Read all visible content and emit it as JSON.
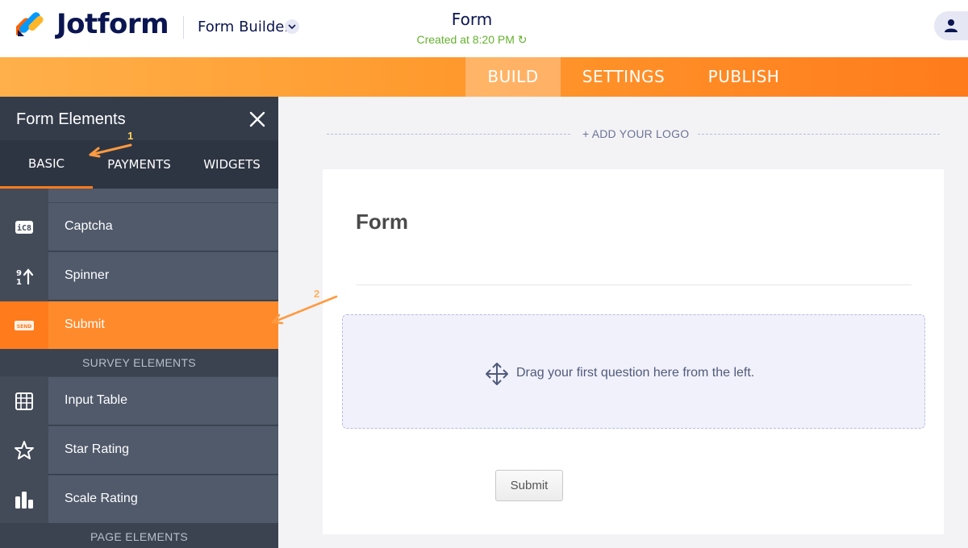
{
  "header": {
    "brand": "Jotform",
    "builder_label": "Form Builder",
    "form_title": "Form",
    "created": "Created at 8:20 PM"
  },
  "nav": {
    "tabs": [
      {
        "label": "BUILD",
        "active": true
      },
      {
        "label": "SETTINGS",
        "active": false
      },
      {
        "label": "PUBLISH",
        "active": false
      }
    ]
  },
  "sidebar": {
    "title": "Form Elements",
    "tabs": [
      {
        "label": "BASIC",
        "active": true
      },
      {
        "label": "PAYMENTS",
        "active": false
      },
      {
        "label": "WIDGETS",
        "active": false
      }
    ],
    "items": [
      {
        "label": "Captcha",
        "icon": "captcha-icon"
      },
      {
        "label": "Spinner",
        "icon": "spinner-icon"
      },
      {
        "label": "Submit",
        "icon": "send-icon",
        "active": true
      }
    ],
    "section_survey": "SURVEY ELEMENTS",
    "survey_items": [
      {
        "label": "Input Table",
        "icon": "table-icon"
      },
      {
        "label": "Star Rating",
        "icon": "star-icon"
      },
      {
        "label": "Scale Rating",
        "icon": "bar-chart-icon"
      }
    ],
    "section_page": "PAGE ELEMENTS",
    "annotations": [
      "1",
      "2"
    ]
  },
  "canvas": {
    "add_logo": "+ ADD YOUR LOGO",
    "form_heading": "Form",
    "dropzone_text": "Drag your first question here from the left.",
    "submit_label": "Submit"
  },
  "colors": {
    "brand_navy": "#0a1551",
    "orange": "#ff7b1c",
    "created_green": "#64b22e",
    "sidebar_bg": "#343c4a"
  }
}
